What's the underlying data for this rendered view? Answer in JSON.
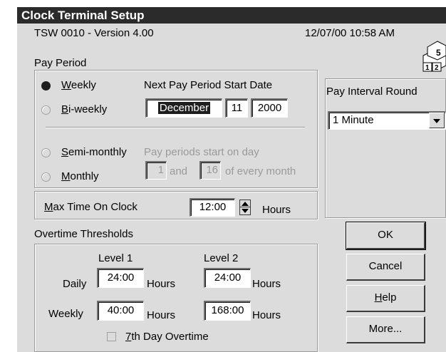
{
  "window": {
    "title": "Clock Terminal Setup",
    "version_line": "TSW 0010 - Version  4.00",
    "datetime": "12/07/00 10:58 AM"
  },
  "pay_period": {
    "group_label": "Pay Period",
    "weekly": {
      "prefix": "",
      "accel": "W",
      "rest": "eekly",
      "selected": true
    },
    "biweekly": {
      "accel": "B",
      "rest": "i-weekly",
      "selected": false
    },
    "semimonthly": {
      "accel": "S",
      "rest": "emi-monthly",
      "selected": false
    },
    "monthly": {
      "accel": "M",
      "rest": "onthly",
      "selected": false
    },
    "next_start_label": "Next Pay Period Start Date",
    "start_month": "December",
    "start_day": "11",
    "start_year": "2000",
    "starts_on_label": "Pay periods start on day",
    "day1": "1",
    "and_label": "and",
    "day2": "16",
    "every_month_label": "of every month"
  },
  "pay_interval": {
    "label": "Pay Interval Round",
    "value": "1 Minute"
  },
  "max_time": {
    "accel": "M",
    "rest": "ax Time On Clock",
    "value": "12:00",
    "unit": "Hours"
  },
  "overtime": {
    "group_label": "Overtime Thresholds",
    "level1_label": "Level 1",
    "level2_label": "Level 2",
    "daily_label": "Daily",
    "weekly_label": "Weekly",
    "daily_l1": "24:00",
    "daily_l2": "24:00",
    "weekly_l1": "40:00",
    "weekly_l2": "168:00",
    "hours_label": "Hours",
    "seventh_accel": "7",
    "seventh_rest": "th Day Overtime",
    "seventh_checked": false
  },
  "buttons": {
    "ok": "OK",
    "cancel": "Cancel",
    "help_accel": "H",
    "help_rest": "elp",
    "more": "More..."
  },
  "colors": {
    "title_bar": "#2b2b2b",
    "dialog_face": "#dcdcdc",
    "disabled_text": "#9a9a9a"
  },
  "icons": {
    "dropdown": "chevron-down-icon",
    "calendar_blocks": "calendar-blocks-icon",
    "spinner": "spin-up-down-icon"
  }
}
